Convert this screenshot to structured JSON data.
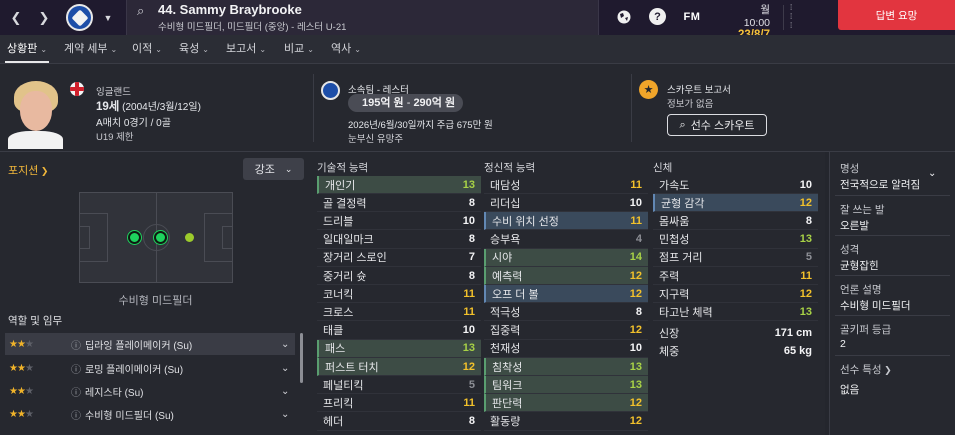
{
  "header": {
    "player_title": "44. Sammy Braybrooke",
    "player_sub": "수비형 미드필더, 미드필더 (중앙) - 레스터 U-21",
    "fm_logo": "FM",
    "time": "월 10:00",
    "date": "23/8/7",
    "reply_label": "답변 요망"
  },
  "tabs": [
    {
      "label": "상황판",
      "chevron": "⌄"
    },
    {
      "label": "계약 세부",
      "chevron": "⌄"
    },
    {
      "label": "이적",
      "chevron": "⌄"
    },
    {
      "label": "육성",
      "chevron": "⌄"
    },
    {
      "label": "보고서",
      "chevron": "⌄"
    },
    {
      "label": "비교",
      "chevron": "⌄"
    },
    {
      "label": "역사",
      "chevron": "⌄"
    }
  ],
  "profile": {
    "nation": "잉글랜드",
    "age_bold": "19세",
    "age_rest": " (2004년/3월/12일)",
    "apps": "A매치 0경기 / 0골",
    "eligibility": "U19 제한",
    "club_line": "소속팀 - 레스터",
    "value_from": "195억 원",
    "value_sep": " - ",
    "value_to": "290억 원",
    "contract": "2026년/6월/30일까지 주급 675만 원",
    "prospect": "눈부신 유망주",
    "scout_title": "스카우트 보고서",
    "scout_status": "정보가 없음",
    "scout_button": "선수 스카우트"
  },
  "position": {
    "link": "포지션",
    "emphasis": "강조",
    "label": "수비형 미드필더"
  },
  "roles": {
    "title": "역할 및 임무",
    "items": [
      {
        "name": "딥라잉 플레이메이커 (Su)",
        "filled": "★★",
        "empty": "★",
        "info": "ⓘ"
      },
      {
        "name": "로밍 플레이메이커 (Su)",
        "filled": "★★",
        "empty": "★",
        "info": "ⓘ"
      },
      {
        "name": "레지스타 (Su)",
        "filled": "★★",
        "empty": "★",
        "info": "ⓘ"
      },
      {
        "name": "수비형 미드필더 (Su)",
        "filled": "★★",
        "empty": "★",
        "info": "ⓘ"
      }
    ]
  },
  "attributes": {
    "technical_title": "기술적 능력",
    "mental_title": "정신적 능력",
    "physical_title": "신체",
    "technical": [
      {
        "name": "개인기",
        "value": "13"
      },
      {
        "name": "골 결정력",
        "value": "8"
      },
      {
        "name": "드리블",
        "value": "10"
      },
      {
        "name": "일대일마크",
        "value": "8"
      },
      {
        "name": "장거리 스로인",
        "value": "7"
      },
      {
        "name": "중거리 슛",
        "value": "8"
      },
      {
        "name": "코너킥",
        "value": "11"
      },
      {
        "name": "크로스",
        "value": "11"
      },
      {
        "name": "태클",
        "value": "10"
      },
      {
        "name": "패스",
        "value": "13"
      },
      {
        "name": "퍼스트 터치",
        "value": "12"
      },
      {
        "name": "페널티킥",
        "value": "5"
      },
      {
        "name": "프리킥",
        "value": "11"
      },
      {
        "name": "헤더",
        "value": "8"
      }
    ],
    "mental": [
      {
        "name": "대담성",
        "value": "11"
      },
      {
        "name": "리더십",
        "value": "10"
      },
      {
        "name": "수비 위치 선정",
        "value": "11"
      },
      {
        "name": "승부욕",
        "value": "4"
      },
      {
        "name": "시야",
        "value": "14"
      },
      {
        "name": "예측력",
        "value": "12"
      },
      {
        "name": "오프 더 볼",
        "value": "12"
      },
      {
        "name": "적극성",
        "value": "8"
      },
      {
        "name": "집중력",
        "value": "12"
      },
      {
        "name": "천재성",
        "value": "10"
      },
      {
        "name": "침착성",
        "value": "13"
      },
      {
        "name": "팀워크",
        "value": "13"
      },
      {
        "name": "판단력",
        "value": "12"
      },
      {
        "name": "활동량",
        "value": "12"
      }
    ],
    "physical": [
      {
        "name": "가속도",
        "value": "10"
      },
      {
        "name": "균형 감각",
        "value": "12"
      },
      {
        "name": "몸싸움",
        "value": "8"
      },
      {
        "name": "민첩성",
        "value": "13"
      },
      {
        "name": "점프 거리",
        "value": "5"
      },
      {
        "name": "주력",
        "value": "11"
      },
      {
        "name": "지구력",
        "value": "12"
      },
      {
        "name": "타고난 체력",
        "value": "13"
      }
    ],
    "height_label": "신장",
    "height_value": "171 cm",
    "weight_label": "체중",
    "weight_value": "65 kg"
  },
  "side": {
    "reputation_label": "명성",
    "reputation_value": "전국적으로 알려짐",
    "foot_label": "잘 쓰는 발",
    "foot_value": "오른발",
    "personality_label": "성격",
    "personality_value": "균형잡힌",
    "media_label": "언론 설명",
    "media_value": "수비형 미드필더",
    "gk_label": "골키퍼 등급",
    "gk_value": "2",
    "traits_label": "선수 특성",
    "traits_value": "없음"
  },
  "colors": {
    "accent_gold": "#f2c12b",
    "accent_green": "#a8d246",
    "reply_red": "#e2353f",
    "highlight_green": "#3d4c45",
    "highlight_blue": "#3a4a5c"
  }
}
